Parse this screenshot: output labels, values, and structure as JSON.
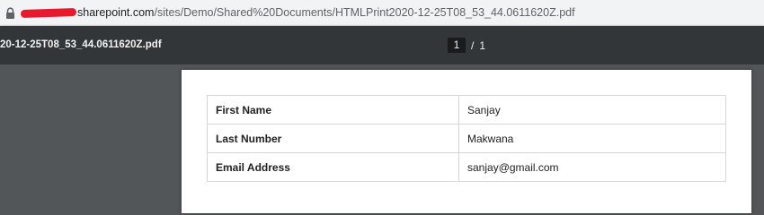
{
  "address_bar": {
    "host": "sharepoint.com",
    "path": "/sites/Demo/Shared%20Documents/HTMLPrint2020-12-25T08_53_44.0611620Z.pdf"
  },
  "toolbar": {
    "title": "20-12-25T08_53_44.0611620Z.pdf",
    "current_page": "1",
    "separator": "/",
    "total_pages": "1"
  },
  "document": {
    "rows": [
      {
        "label": "First Name",
        "value": "Sanjay"
      },
      {
        "label": "Last Number",
        "value": "Makwana"
      },
      {
        "label": "Email Address",
        "value": "sanjay@gmail.com"
      }
    ]
  }
}
